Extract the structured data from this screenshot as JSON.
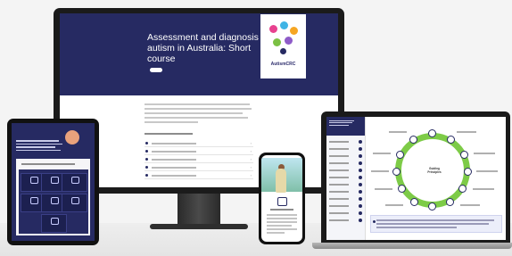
{
  "course": {
    "title": "Assessment and diagnosis of autism in Australia: Short course",
    "logo_text": "AutismCRC"
  },
  "laptop": {
    "diagram_center_label": "Guiding Principles"
  },
  "colors": {
    "navy": "#262a62",
    "ring_green": "#7dcb47"
  }
}
